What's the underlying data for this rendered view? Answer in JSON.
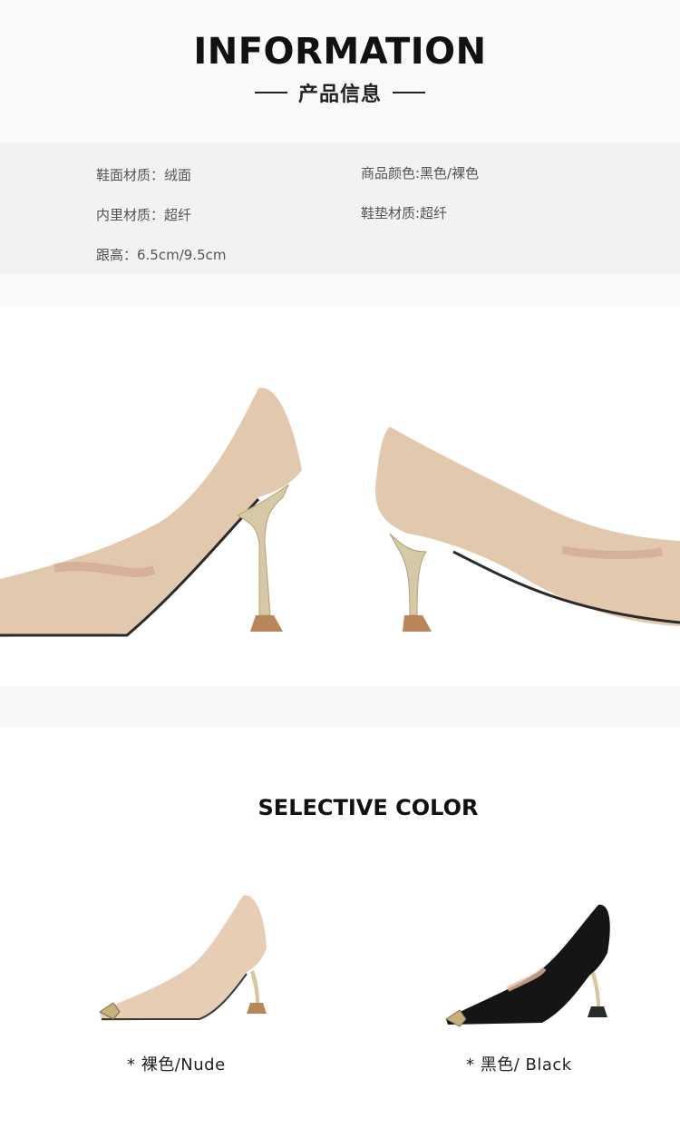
{
  "header": {
    "title": "INFORMATION",
    "subtitle": "产品信息"
  },
  "info": {
    "upper_material": "鞋面材质：绒面",
    "color": "商品颜色:黑色/裸色",
    "lining_material": "内里材质：超纤",
    "insole_material": "鞋垫材质:超纤",
    "heel_height": "跟高：6.5cm/9.5cm"
  },
  "selection": {
    "title": "SELECTIVE COLOR",
    "options": [
      {
        "label": "* 裸色/Nude",
        "color": "#e6cdb3"
      },
      {
        "label": "* 黑色/ Black",
        "color": "#151515"
      }
    ]
  },
  "colors": {
    "nude": "#e3cbb2",
    "black": "#141414",
    "gold": "#d8c59a"
  }
}
